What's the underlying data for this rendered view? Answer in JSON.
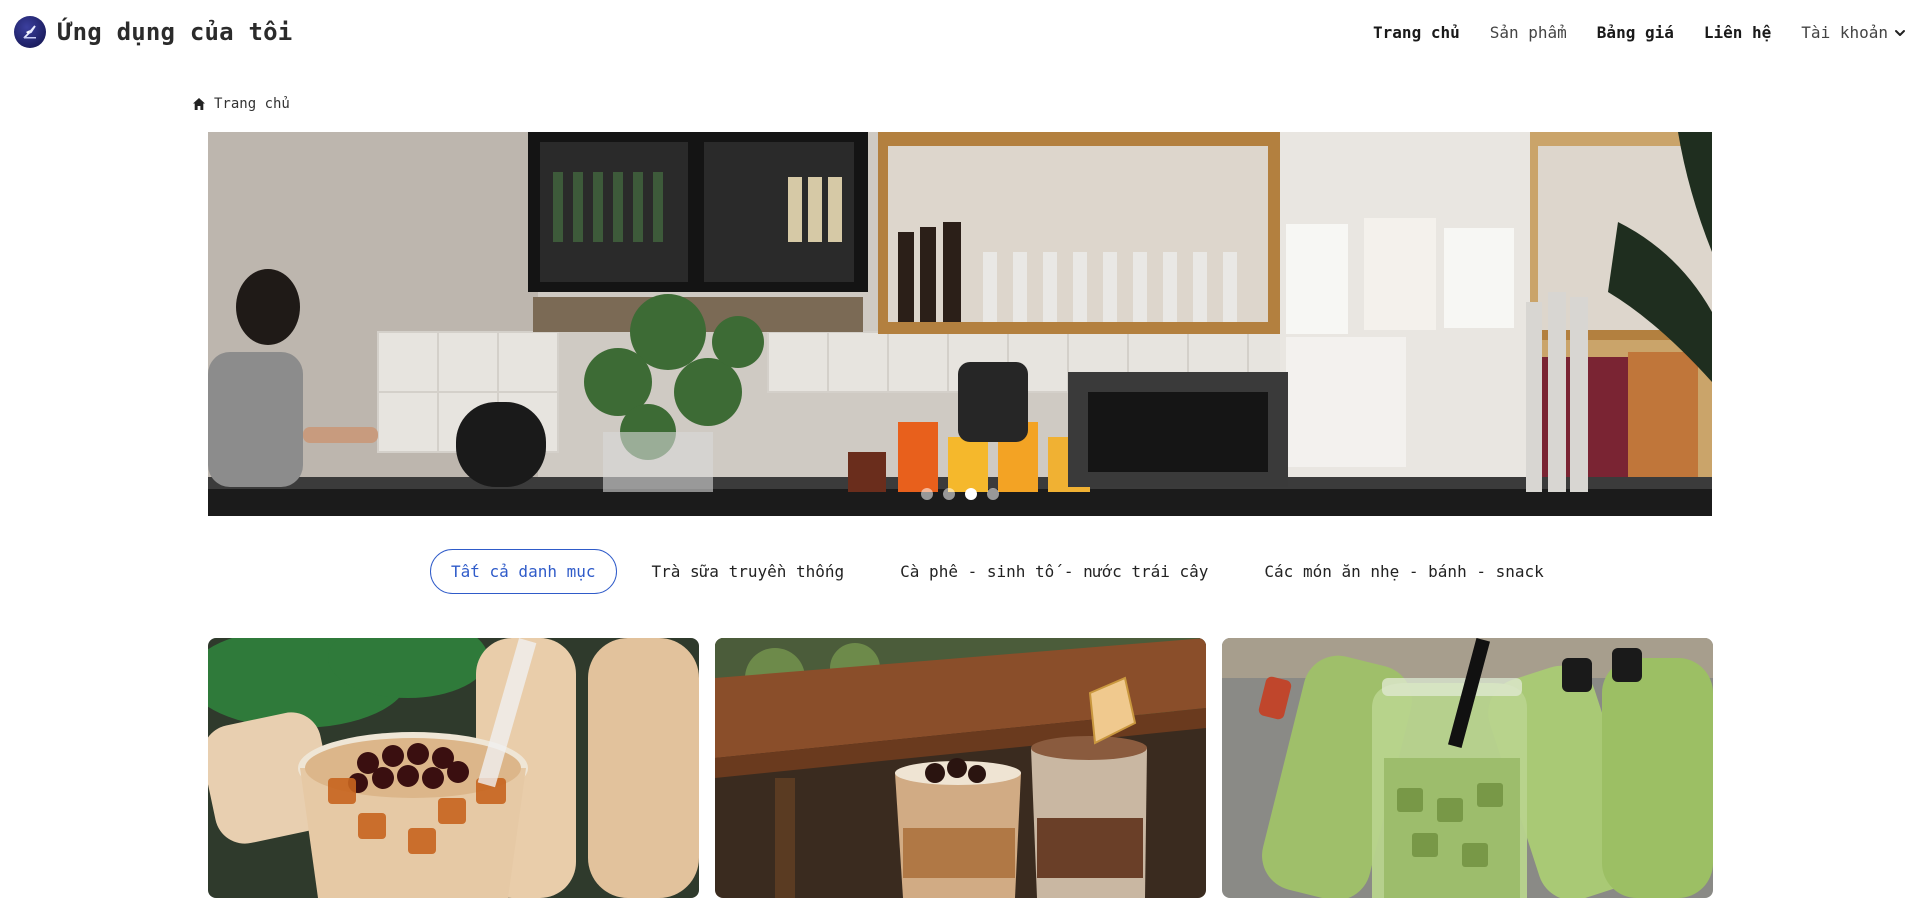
{
  "header": {
    "app_title": "Ứng dụng của tôi",
    "logo_icon": "rocket-logo-icon",
    "nav": {
      "home": "Trang chủ",
      "products": "Sản phẩm",
      "pricing": "Bảng giá",
      "contact": "Liên hệ",
      "account": "Tài khoản"
    }
  },
  "breadcrumb": {
    "icon": "home-icon",
    "label": "Trang chủ"
  },
  "carousel": {
    "slide_count": 4,
    "active_index": 2
  },
  "categories": {
    "all": "Tất cả danh mục",
    "milk_tea": "Trà sữa truyền thống",
    "coffee": "Cà phê - sinh tố - nước trái cây",
    "snacks": "Các món ăn nhẹ - bánh - snack",
    "active_color": "#2f5bc9"
  }
}
